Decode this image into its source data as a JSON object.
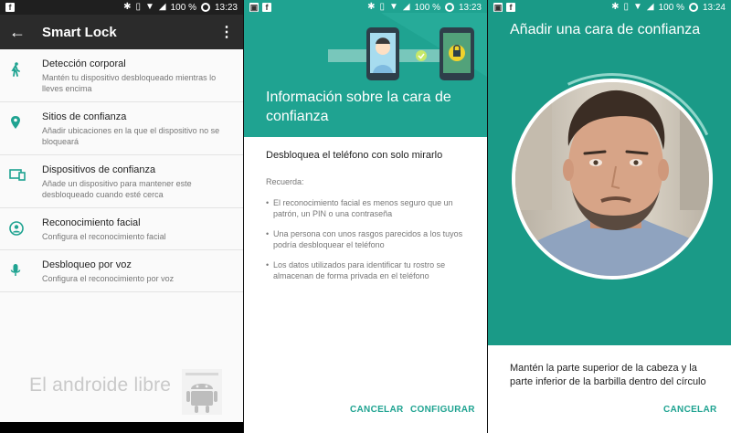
{
  "status_bar": {
    "battery": "100 %",
    "times": [
      "13:23",
      "13:23",
      "13:24"
    ]
  },
  "panel1": {
    "title": "Smart Lock",
    "items": [
      {
        "icon": "walking-person-icon",
        "title": "Detección corporal",
        "subtitle": "Mantén tu dispositivo desbloqueado mientras lo lleves encima"
      },
      {
        "icon": "location-pin-icon",
        "title": "Sitios de confianza",
        "subtitle": "Añadir ubicaciones en la que el dispositivo no se bloqueará"
      },
      {
        "icon": "devices-icon",
        "title": "Dispositivos de confianza",
        "subtitle": "Añade un dispositivo para mantener este desbloqueado cuando esté cerca"
      },
      {
        "icon": "face-icon",
        "title": "Reconocimiento facial",
        "subtitle": "Configura el reconocimiento facial"
      },
      {
        "icon": "microphone-icon",
        "title": "Desbloqueo por voz",
        "subtitle": "Configura el reconocimiento por voz"
      }
    ],
    "watermark": "El androide libre"
  },
  "panel2": {
    "title": "Información sobre la cara de confianza",
    "lead": "Desbloquea el teléfono con solo mirarlo",
    "recuerda": "Recuerda:",
    "bullets": [
      "El reconocimiento facial es menos seguro que un patrón, un PIN o una contraseña",
      "Una persona con unos rasgos parecidos a los tuyos podría desbloquear el teléfono",
      "Los datos utilizados para identificar tu rostro se almacenan de forma privada en el teléfono"
    ],
    "cancel": "CANCELAR",
    "configure": "CONFIGURAR"
  },
  "panel3": {
    "title": "Añadir una cara de confianza",
    "instruction": "Mantén la parte superior de la cabeza y la parte inferior de la barbilla dentro del círculo",
    "cancel": "CANCELAR"
  },
  "colors": {
    "teal": "#1fa391",
    "dark_bar": "#2b2b2b"
  }
}
